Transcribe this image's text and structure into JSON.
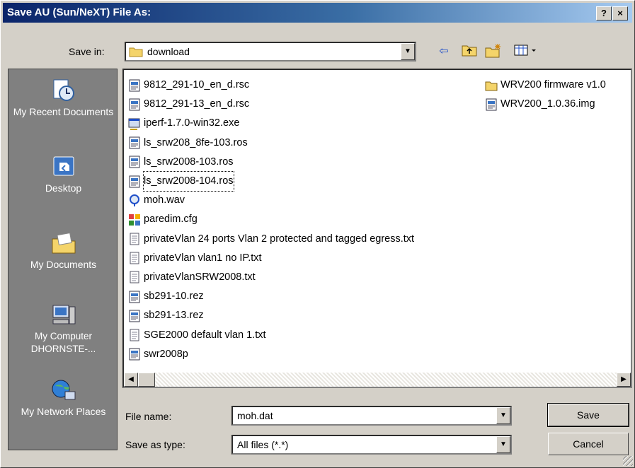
{
  "window": {
    "title": "Save AU (Sun/NeXT) File As:",
    "help_label": "?",
    "close_label": "×"
  },
  "save_in": {
    "label": "Save in:",
    "value": "download"
  },
  "toolbar": {
    "back_glyph": "⇦",
    "up_glyph": "⬑",
    "newfolder_glyph": "✱",
    "views_glyph": "▦▾"
  },
  "places": [
    {
      "label": "My Recent Documents",
      "icon": "recent-documents-icon"
    },
    {
      "label": "Desktop",
      "icon": "desktop-icon"
    },
    {
      "label": "My Documents",
      "icon": "my-documents-icon"
    },
    {
      "label": "My Computer DHORNSTE-...",
      "icon": "my-computer-icon"
    },
    {
      "label": "My Network Places",
      "icon": "network-places-icon"
    }
  ],
  "files_col1": [
    {
      "name": "9812_291-10_en_d.rsc",
      "icon": "binary-file-icon"
    },
    {
      "name": "9812_291-13_en_d.rsc",
      "icon": "binary-file-icon"
    },
    {
      "name": "iperf-1.7.0-win32.exe",
      "icon": "exe-file-icon"
    },
    {
      "name": "ls_srw208_8fe-103.ros",
      "icon": "binary-file-icon"
    },
    {
      "name": "ls_srw2008-103.ros",
      "icon": "binary-file-icon"
    },
    {
      "name": "ls_srw2008-104.ros",
      "icon": "binary-file-icon",
      "selected": true
    },
    {
      "name": "moh.wav",
      "icon": "audio-file-icon"
    },
    {
      "name": "paredim.cfg",
      "icon": "config-file-icon"
    },
    {
      "name": "privateVlan 24 ports Vlan 2 protected and tagged egress.txt",
      "icon": "text-file-icon"
    },
    {
      "name": "privateVlan vlan1 no IP.txt",
      "icon": "text-file-icon"
    },
    {
      "name": "privateVlanSRW2008.txt",
      "icon": "text-file-icon"
    },
    {
      "name": "sb291-10.rez",
      "icon": "binary-file-icon"
    },
    {
      "name": "sb291-13.rez",
      "icon": "binary-file-icon"
    },
    {
      "name": "SGE2000 default vlan 1.txt",
      "icon": "text-file-icon"
    },
    {
      "name": "swr2008p",
      "icon": "binary-file-icon"
    }
  ],
  "files_col2": [
    {
      "name": "WRV200 firmware v1.0",
      "icon": "folder-icon"
    },
    {
      "name": "WRV200_1.0.36.img",
      "icon": "binary-file-icon"
    }
  ],
  "filename": {
    "label": "File name:",
    "value": "moh.dat"
  },
  "filetype": {
    "label": "Save as type:",
    "value": "All files (*.*)"
  },
  "buttons": {
    "save": "Save",
    "cancel": "Cancel"
  },
  "colors": {
    "titlebar_start": "#0a246a",
    "titlebar_end": "#a6caf0",
    "face": "#d4d0c8",
    "places_bg": "#808080"
  }
}
